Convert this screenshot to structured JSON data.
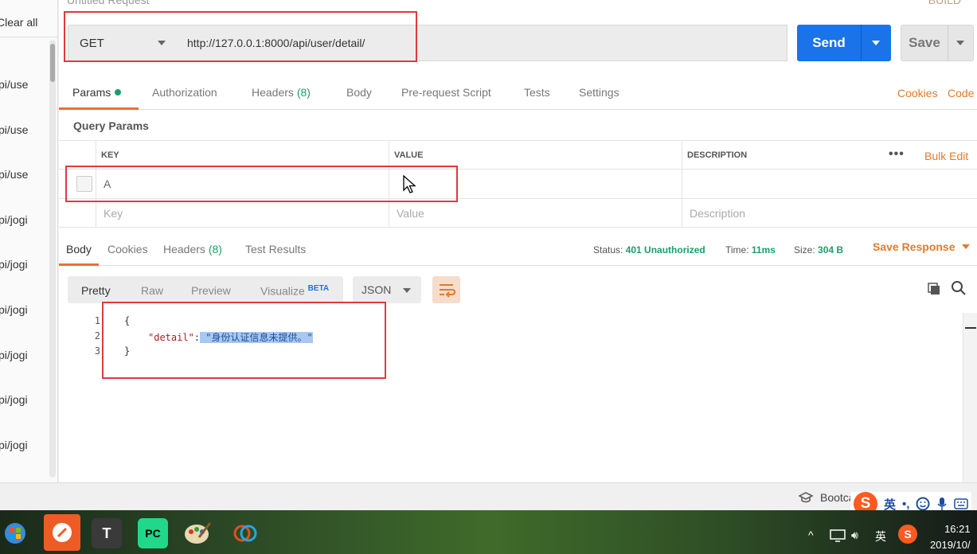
{
  "header": {
    "title": "Untitled Request",
    "right_hint": "BUILD"
  },
  "sidebar": {
    "clear_all": "Clear all",
    "history": [
      "pi/use",
      "pi/use",
      "pi/use",
      "pi/jogi",
      "pi/jogi",
      "pi/jogi",
      "pi/jogi",
      "pi/jogi",
      "pi/jogi"
    ]
  },
  "request": {
    "method": "GET",
    "url": "http://127.0.0.1:8000/api/user/detail/",
    "send_label": "Send",
    "save_label": "Save"
  },
  "tabs": {
    "params": "Params",
    "authorization": "Authorization",
    "headers": "Headers",
    "headers_count": "(8)",
    "body": "Body",
    "prerequest": "Pre-request Script",
    "tests": "Tests",
    "settings": "Settings",
    "cookies": "Cookies",
    "code": "Code"
  },
  "query_params": {
    "title": "Query Params",
    "columns": {
      "key": "KEY",
      "value": "VALUE",
      "description": "DESCRIPTION"
    },
    "bulk_edit": "Bulk Edit",
    "rows": [
      {
        "key": "A",
        "value": "",
        "description": ""
      }
    ],
    "placeholder": {
      "key": "Key",
      "value": "Value",
      "description": "Description"
    }
  },
  "response": {
    "tabs": {
      "body": "Body",
      "cookies": "Cookies",
      "headers": "Headers",
      "headers_count": "(8)",
      "test_results": "Test Results"
    },
    "status_label": "Status:",
    "status_value": "401 Unauthorized",
    "time_label": "Time:",
    "time_value": "11ms",
    "size_label": "Size:",
    "size_value": "304 B",
    "save_response": "Save Response",
    "views": {
      "pretty": "Pretty",
      "raw": "Raw",
      "preview": "Preview",
      "visualize": "Visualize",
      "beta": "BETA"
    },
    "format": "JSON",
    "code": {
      "lines": [
        "1",
        "2",
        "3"
      ],
      "open": "{",
      "key": "\"detail\"",
      "colon": ":",
      "value": " \"身份认证信息未提供。\"",
      "close": "}"
    }
  },
  "status_strip": {
    "bootcamp": "Bootcamp",
    "ime_logo": "S",
    "ime_lang": "英"
  },
  "taskbar": {
    "time": "16:21",
    "date": "2019/10/",
    "tray_lang": "英",
    "apps": [
      "T",
      "PC"
    ]
  },
  "colors": {
    "accent": "#f26b3a",
    "send": "#1a73e8",
    "success_green": "#1a9e6a",
    "link_orange": "#e07b2a",
    "annotation_red": "#e0393e"
  }
}
